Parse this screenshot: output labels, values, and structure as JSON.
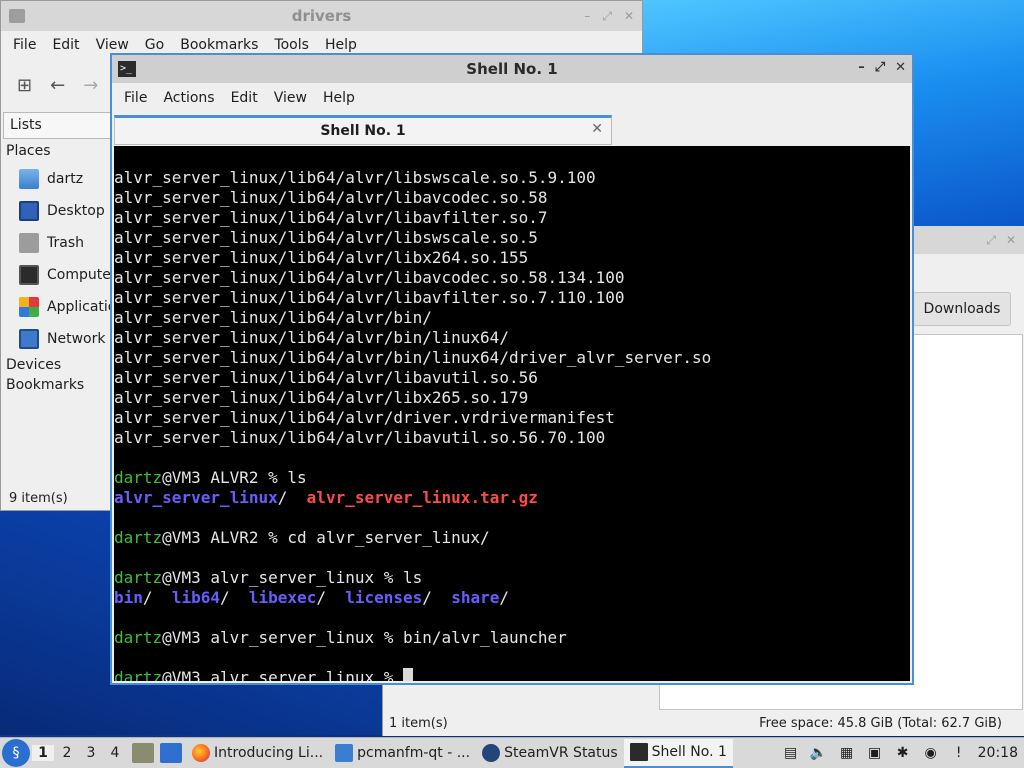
{
  "desktop": {},
  "file_manager": {
    "title": "drivers",
    "menu": [
      "File",
      "Edit",
      "View",
      "Go",
      "Bookmarks",
      "Tools",
      "Help"
    ],
    "side_mode": "Lists",
    "places_header": "Places",
    "places": [
      {
        "label": "dartz",
        "icon": "home-folder-icon"
      },
      {
        "label": "Desktop",
        "icon": "desktop-icon"
      },
      {
        "label": "Trash",
        "icon": "trash-icon"
      },
      {
        "label": "Computer",
        "icon": "computer-icon"
      },
      {
        "label": "Applications",
        "icon": "applications-icon"
      },
      {
        "label": "Network",
        "icon": "network-icon"
      }
    ],
    "devices_header": "Devices",
    "bookmarks_header": "Bookmarks",
    "status": "9 item(s)"
  },
  "file_manager_2": {
    "downloads_button": "Downloads",
    "status_left": "1 item(s)",
    "status_right": "Free space: 45.8 GiB (Total: 62.7 GiB)"
  },
  "terminal": {
    "title": "Shell No. 1",
    "menu": [
      "File",
      "Actions",
      "Edit",
      "View",
      "Help"
    ],
    "tab_label": "Shell No. 1",
    "lines": [
      "alvr_server_linux/lib64/alvr/libswscale.so.5.9.100",
      "alvr_server_linux/lib64/alvr/libavcodec.so.58",
      "alvr_server_linux/lib64/alvr/libavfilter.so.7",
      "alvr_server_linux/lib64/alvr/libswscale.so.5",
      "alvr_server_linux/lib64/alvr/libx264.so.155",
      "alvr_server_linux/lib64/alvr/libavcodec.so.58.134.100",
      "alvr_server_linux/lib64/alvr/libavfilter.so.7.110.100",
      "alvr_server_linux/lib64/alvr/bin/",
      "alvr_server_linux/lib64/alvr/bin/linux64/",
      "alvr_server_linux/lib64/alvr/bin/linux64/driver_alvr_server.so",
      "alvr_server_linux/lib64/alvr/libavutil.so.56",
      "alvr_server_linux/lib64/alvr/libx265.so.179",
      "alvr_server_linux/lib64/alvr/driver.vrdrivermanifest",
      "alvr_server_linux/lib64/alvr/libavutil.so.56.70.100"
    ],
    "prompt_user": "dartz",
    "prompt1": "@VM3 ALVR2 % ls",
    "ls1_dir": "alvr_server_linux",
    "ls1_dir_suffix": "/  ",
    "ls1_file": "alvr_server_linux.tar.gz",
    "prompt2": "@VM3 ALVR2 % cd alvr_server_linux/",
    "prompt3": "@VM3 alvr_server_linux % ls",
    "ls2": [
      "bin",
      "lib64",
      "libexec",
      "licenses",
      "share"
    ],
    "prompt4": "@VM3 alvr_server_linux % bin/alvr_launcher",
    "prompt5": "@VM3 alvr_server_linux % "
  },
  "taskbar": {
    "desktops": [
      "1",
      "2",
      "3",
      "4"
    ],
    "tasks": [
      {
        "label": "Introducing Li...",
        "icon": "firefox-icon"
      },
      {
        "label": "pcmanfm-qt - ...",
        "icon": "folder-icon"
      },
      {
        "label": "SteamVR Status",
        "icon": "steamvr-icon"
      },
      {
        "label": "Shell No. 1",
        "icon": "terminal-icon"
      }
    ],
    "clock": "20:18"
  }
}
